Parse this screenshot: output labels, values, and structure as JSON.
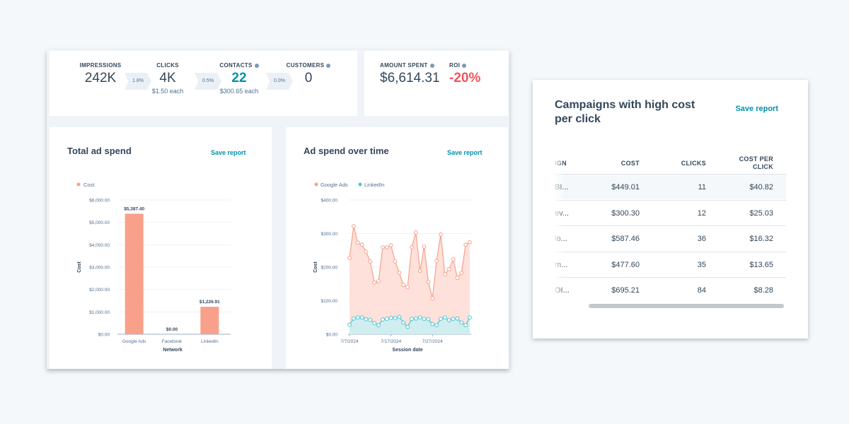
{
  "funnel": {
    "metrics": [
      {
        "label": "IMPRESSIONS",
        "value": "242K",
        "sub": "",
        "info": false
      },
      {
        "label": "CLICKS",
        "value": "4K",
        "sub": "$1.50 each",
        "info": false
      },
      {
        "label": "CONTACTS",
        "value": "22",
        "sub": "$300.65 each",
        "info": true
      },
      {
        "label": "CUSTOMERS",
        "value": "0",
        "sub": "",
        "info": true
      }
    ],
    "rates": [
      "1.8%",
      "0.5%",
      "0.0%"
    ]
  },
  "spend": {
    "amount_label": "AMOUNT SPENT",
    "amount_value": "$6,614.31",
    "roi_label": "ROI",
    "roi_value": "-20%"
  },
  "colors": {
    "google_ads": "#f8a08a",
    "google_ads_fill": "#fddcd3",
    "linkedin": "#4fc6d3",
    "linkedin_fill": "#c8eef2",
    "accent": "#0091ae",
    "negative": "#f2545b"
  },
  "bar_card": {
    "title": "Total ad spend",
    "save_label": "Save report"
  },
  "line_card": {
    "title": "Ad spend over time",
    "save_label": "Save report"
  },
  "chart_data": [
    {
      "type": "bar",
      "title": "Total ad spend",
      "legend": [
        "Cost"
      ],
      "legend_position": "top-left",
      "categories": [
        "Google Ads",
        "Facebook",
        "LinkedIn"
      ],
      "values": [
        5387.4,
        0.0,
        1226.91
      ],
      "data_labels": [
        "$5,387.40",
        "$0.00",
        "$1,226.91"
      ],
      "xlabel": "Network",
      "ylabel": "Cost",
      "ylim": [
        0,
        6000
      ],
      "yticks": [
        0,
        1000,
        2000,
        3000,
        4000,
        5000,
        6000
      ],
      "ytick_labels": [
        "$0.00",
        "$1,000.00",
        "$2,000.00",
        "$3,000.00",
        "$4,000.00",
        "$5,000.00",
        "$6,000.00"
      ],
      "grid": true
    },
    {
      "type": "area",
      "title": "Ad spend over time",
      "legend": [
        "Google Ads",
        "LinkedIn"
      ],
      "legend_position": "top-left",
      "x_start": "7/7/2024",
      "x_count": 30,
      "xtick_labels": [
        "7/7/2024",
        "7/17/2024",
        "7/27/2024"
      ],
      "xtick_index": [
        0,
        10,
        20
      ],
      "xlabel": "Session date",
      "ylabel": "Cost",
      "ylim": [
        0,
        400
      ],
      "yticks": [
        0,
        100,
        200,
        300,
        400
      ],
      "ytick_labels": [
        "$0.00",
        "$100.00",
        "$200.00",
        "$300.00",
        "$400.00"
      ],
      "grid": true,
      "series": [
        {
          "name": "Google Ads",
          "values": [
            227,
            322,
            273,
            267,
            246,
            217,
            154,
            158,
            259,
            259,
            265,
            217,
            183,
            147,
            141,
            259,
            303,
            189,
            261,
            156,
            107,
            219,
            297,
            179,
            194,
            223,
            168,
            183,
            267,
            274
          ]
        },
        {
          "name": "LinkedIn",
          "values": [
            28,
            47,
            50,
            50,
            45,
            43,
            33,
            27,
            44,
            46,
            49,
            48,
            52,
            35,
            22,
            46,
            47,
            50,
            46,
            45,
            30,
            27,
            46,
            50,
            42,
            46,
            47,
            35,
            27,
            50
          ]
        }
      ]
    }
  ],
  "table_card": {
    "title": "Campaigns with high cost per click",
    "save_label": "Save report",
    "columns": [
      "IGN",
      "COST",
      "CLICKS",
      "COST PER CLICK"
    ],
    "rows": [
      {
        "campaign": "BI...",
        "cost": "$449.01",
        "clicks": "11",
        "cpc": "$40.82"
      },
      {
        "campaign": "ev...",
        "cost": "$300.30",
        "clicks": "12",
        "cpc": "$25.03"
      },
      {
        "campaign": "lo...",
        "cost": "$587.46",
        "clicks": "36",
        "cpc": "$16.32"
      },
      {
        "campaign": "m...",
        "cost": "$477.60",
        "clicks": "35",
        "cpc": "$13.65"
      },
      {
        "campaign": "OI...",
        "cost": "$695.21",
        "clicks": "84",
        "cpc": "$8.28"
      }
    ]
  }
}
